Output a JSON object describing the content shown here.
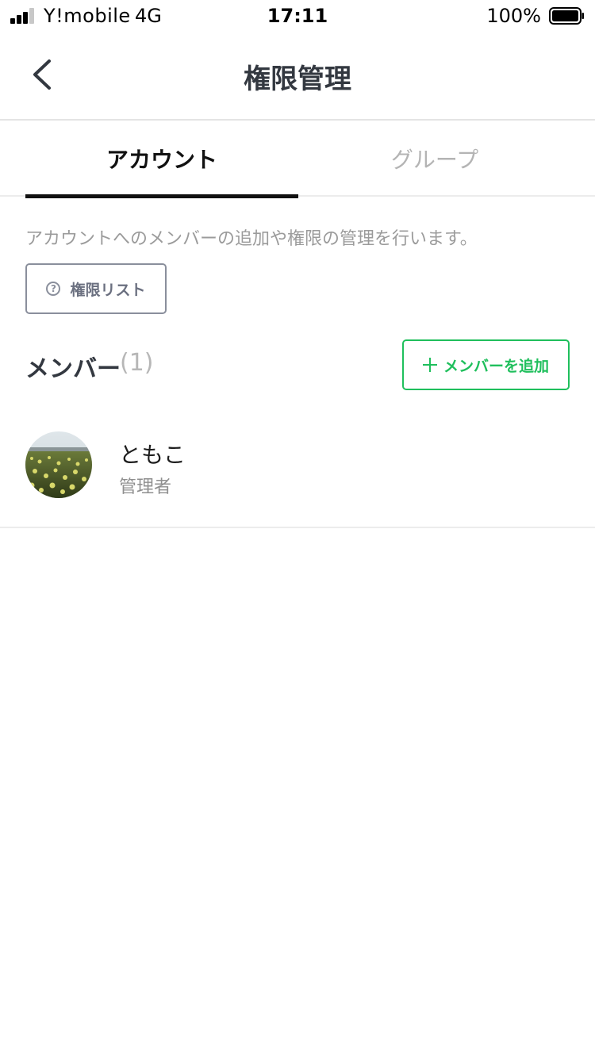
{
  "status_bar": {
    "carrier": "Y!mobile",
    "network": "4G",
    "time": "17:11",
    "battery": "100%"
  },
  "header": {
    "title": "権限管理",
    "back_icon": "chevron-left-icon"
  },
  "tabs": [
    {
      "label": "アカウント",
      "active": true
    },
    {
      "label": "グループ",
      "active": false
    }
  ],
  "description": "アカウントへのメンバーの追加や権限の管理を行います。",
  "permission_list_button": {
    "label": "権限リスト",
    "icon": "help-circle-icon"
  },
  "members": {
    "title": "メンバー",
    "count": "(1)",
    "add_button": {
      "label": "メンバーを追加",
      "icon": "plus-icon"
    },
    "items": [
      {
        "name": "ともこ",
        "role": "管理者"
      }
    ]
  },
  "colors": {
    "accent": "#1fbf5c",
    "title_text": "#333840",
    "secondary_text": "#9b9b9b",
    "divider": "#ececec"
  }
}
